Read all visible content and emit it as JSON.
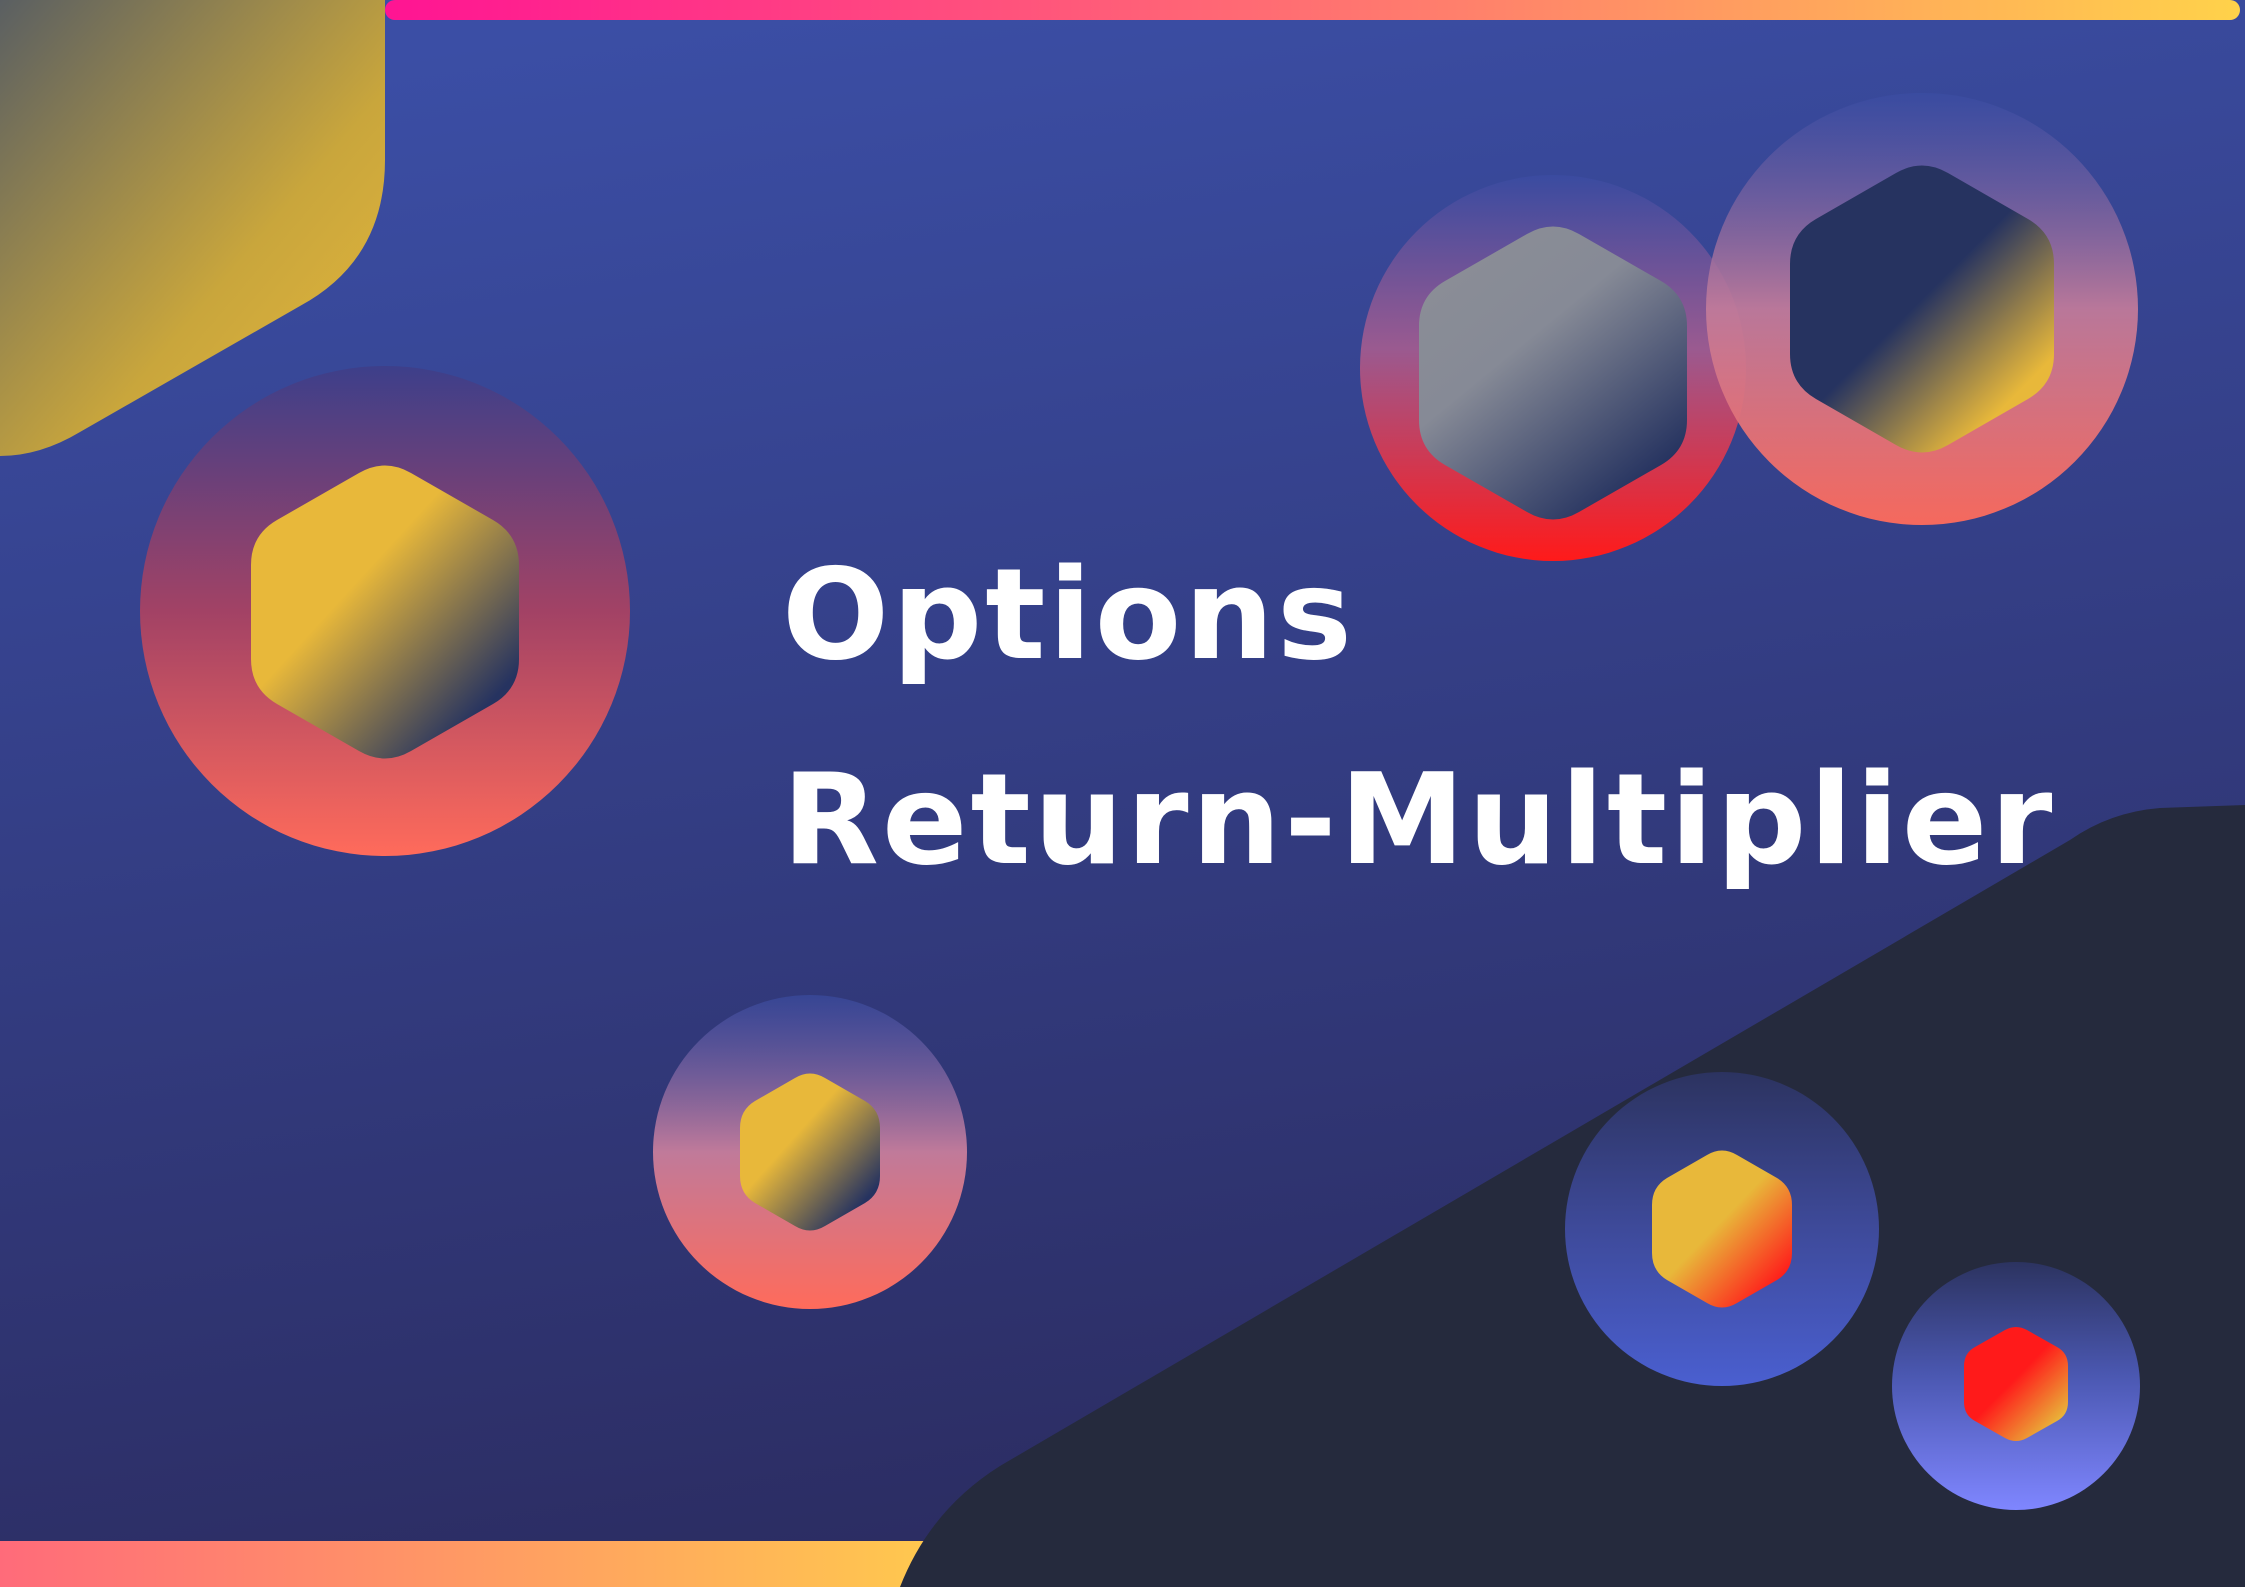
{
  "title": {
    "line1": "Options",
    "line2": "Return-Multiplier"
  },
  "colors": {
    "background_top": "#3b4ea5",
    "background_bottom": "#2b2b5f",
    "dark_panel": "#252a3d",
    "gold": "#e8b83a",
    "coral": "#ff6b5b",
    "red": "#ff1a1a",
    "magenta": "#ff1493",
    "navy": "#263360",
    "periwinkle": "#6e7cff",
    "title_text": "#ffffff"
  },
  "icons": [
    "hexagon-icon-large-left",
    "hexagon-icon-gray-top",
    "hexagon-icon-navy-top-right",
    "hexagon-icon-small-center",
    "hexagon-icon-gold-red-bottom",
    "hexagon-icon-red-bottom-right"
  ]
}
